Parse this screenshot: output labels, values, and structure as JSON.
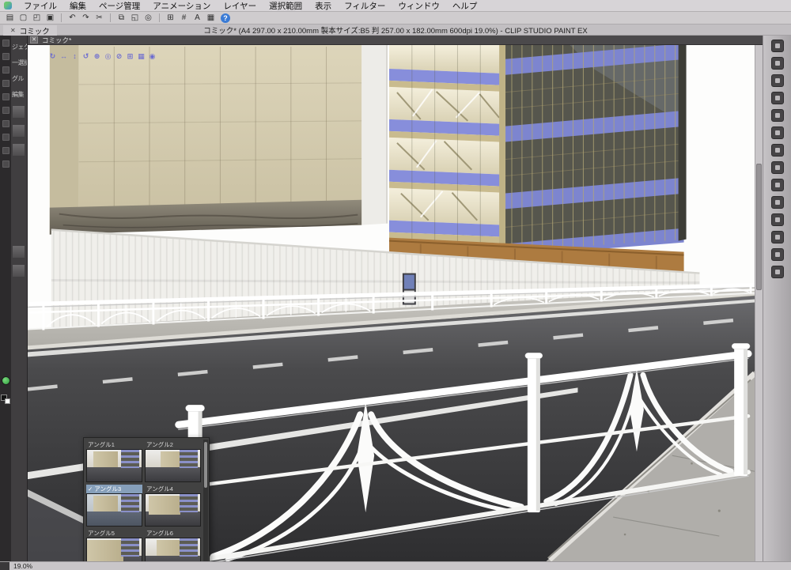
{
  "window": {
    "title": "コミック* (A4 297.00 x 210.00mm 製本サイズ:B5 判 257.00 x 182.00mm 600dpi 19.0%) - CLIP STUDIO PAINT EX"
  },
  "menubar": {
    "items": [
      "ファイル",
      "編集",
      "ページ管理",
      "アニメーション",
      "レイヤー",
      "選択範囲",
      "表示",
      "フィルター",
      "ウィンドウ",
      "ヘルプ"
    ]
  },
  "toolbar": {
    "icons": [
      {
        "name": "menu-icon",
        "glyph": "▤"
      },
      {
        "name": "new-canvas-icon",
        "glyph": "▢"
      },
      {
        "name": "open-file-icon",
        "glyph": "◰"
      },
      {
        "name": "save-icon",
        "glyph": "▣"
      },
      {
        "name": "undo-icon",
        "glyph": "↶"
      },
      {
        "name": "redo-icon",
        "glyph": "↷"
      },
      {
        "name": "cut-icon",
        "glyph": "✂"
      },
      {
        "name": "copy-icon",
        "glyph": "⧉"
      },
      {
        "name": "paste-icon",
        "glyph": "◱"
      },
      {
        "name": "zoom-tool-icon",
        "glyph": "◎"
      },
      {
        "name": "grid-icon",
        "glyph": "⊞"
      },
      {
        "name": "snap-icon",
        "glyph": "#"
      },
      {
        "name": "text-tool-icon",
        "glyph": "A"
      },
      {
        "name": "material-icon",
        "glyph": "▦"
      },
      {
        "name": "help-icon",
        "glyph": "?"
      }
    ]
  },
  "tabbar": {
    "tab_label": "コミック",
    "close_glyph": "✕"
  },
  "canvas_header": {
    "label": "コミック*",
    "close_glyph": "✕"
  },
  "object_toolbar": {
    "icons": [
      {
        "name": "camera-rotate-icon",
        "glyph": "↻"
      },
      {
        "name": "camera-pan-icon",
        "glyph": "↔"
      },
      {
        "name": "camera-zoom-icon",
        "glyph": "↕"
      },
      {
        "name": "camera-roll-icon",
        "glyph": "↺"
      },
      {
        "name": "object-move-icon",
        "glyph": "⊕"
      },
      {
        "name": "object-rotate-y-icon",
        "glyph": "◎"
      },
      {
        "name": "object-rotate-x-icon",
        "glyph": "⊘"
      },
      {
        "name": "object-snap-icon",
        "glyph": "⊞"
      },
      {
        "name": "render-mode-icon",
        "glyph": "▦"
      },
      {
        "name": "light-setting-icon",
        "glyph": "◉"
      }
    ]
  },
  "left_panel": {
    "labels": [
      "ジェクト",
      "一選択",
      "グル",
      "編集"
    ]
  },
  "angle_panel": {
    "check_glyph": "✓",
    "items": [
      {
        "label": "アングル1",
        "selected": false
      },
      {
        "label": "アングル2",
        "selected": false
      },
      {
        "label": "アングル3",
        "selected": true
      },
      {
        "label": "アングル4",
        "selected": false
      },
      {
        "label": "アングル5",
        "selected": false
      },
      {
        "label": "アングル6",
        "selected": false
      }
    ]
  },
  "statusbar": {
    "zoom": "19.0%"
  },
  "colors": {
    "spandrel_blue": "#7d85cf",
    "building_beige": "#d5ccb0",
    "selection_blue": "#869fba",
    "accent_purple": "#6b6bd0",
    "asphalt": "#3a3a3c"
  }
}
